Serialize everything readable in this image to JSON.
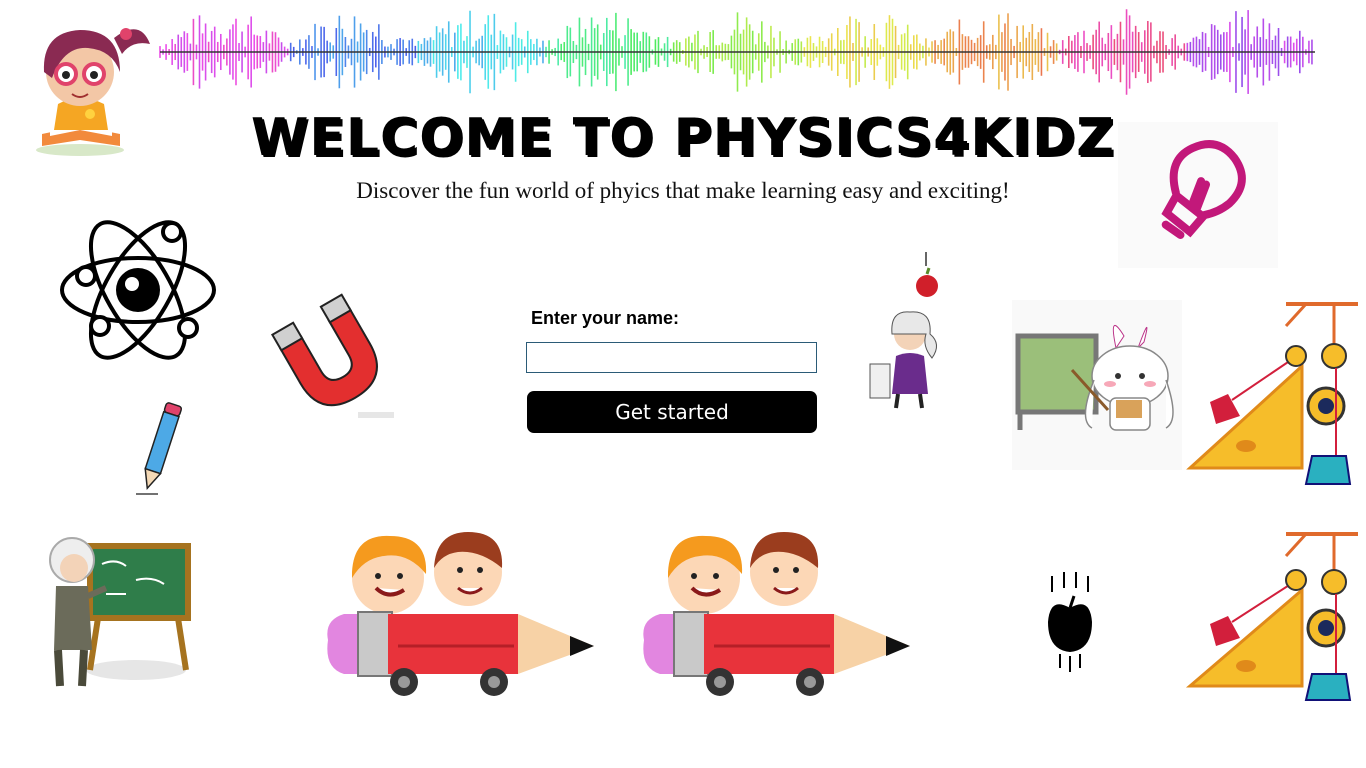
{
  "header": {
    "title": "WELCOME TO PHYSICS4KIDZ",
    "subtitle": "Discover the fun world of phyics that make learning easy and exciting!"
  },
  "form": {
    "name_label": "Enter your name:",
    "name_value": "",
    "name_placeholder": "",
    "button_label": "Get started"
  },
  "illustrations": [
    "girl-reading-icon",
    "sound-wave-banner",
    "atom-icon",
    "magnet-icon",
    "pencil-icon",
    "lightbulb-icon",
    "newton-apple-icon",
    "bunny-teacher-icon",
    "pulley-ramp-icon",
    "einstein-chalkboard-icon",
    "kids-pencil-car-icon",
    "falling-apple-icon"
  ],
  "colors": {
    "button_bg": "#000000",
    "button_text": "#ffffff",
    "input_border": "#2b5b77",
    "accent_magenta": "#c2187a"
  }
}
